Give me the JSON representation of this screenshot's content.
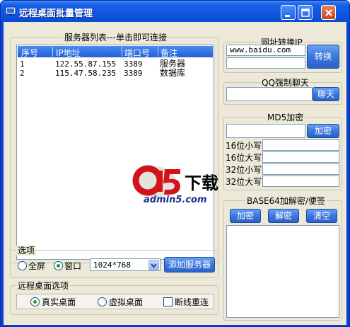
{
  "window": {
    "title": "远程桌面批量管理"
  },
  "server_list": {
    "group_title": "服务器列表---单击即可连接",
    "columns": [
      "序号",
      "IP地址",
      "端口号",
      "备注"
    ],
    "rows": [
      {
        "no": "1",
        "ip": "122.55.87.155",
        "port": "3389",
        "note": "服务器"
      },
      {
        "no": "2",
        "ip": "115.47.58.235",
        "port": "3389",
        "note": "数据库"
      }
    ]
  },
  "options": {
    "group_title": "选项",
    "fullscreen_label": "全屏",
    "window_label": "窗口",
    "selected_mode": "窗口",
    "resolution": "1024*768",
    "add_server_label": "添加服务器"
  },
  "desktop_options": {
    "group_title": "远程桌面选项",
    "real_label": "真实桌面",
    "virtual_label": "虚拟桌面",
    "reconnect_label": "断线重连",
    "selected": "真实桌面",
    "reconnect_checked": false
  },
  "url_convert": {
    "group_title": "网址转换IP",
    "url_value": "www.baidu.com",
    "result_value": "",
    "button_label": "转换"
  },
  "qq_chat": {
    "group_title": "QQ强制聊天",
    "qq_value": "",
    "button_label": "聊天"
  },
  "md5": {
    "group_title": "MD5加密",
    "input_value": "",
    "button_label": "加密",
    "rows": [
      {
        "label": "16位小写",
        "value": ""
      },
      {
        "label": "16位大写",
        "value": ""
      },
      {
        "label": "32位小写",
        "value": ""
      },
      {
        "label": "32位大写",
        "value": ""
      }
    ]
  },
  "base64": {
    "group_title": "BASE64加解密/便签",
    "encrypt_label": "加密",
    "decrypt_label": "解密",
    "clear_label": "清空",
    "note_value": ""
  },
  "watermark": {
    "brand": "a5",
    "text": "下载",
    "site": "admin5.com"
  },
  "colors": {
    "title_blue": "#0f55e0",
    "face": "#ece9d8",
    "header_blue": "#2160d8",
    "button_blue": "#3b77de"
  }
}
